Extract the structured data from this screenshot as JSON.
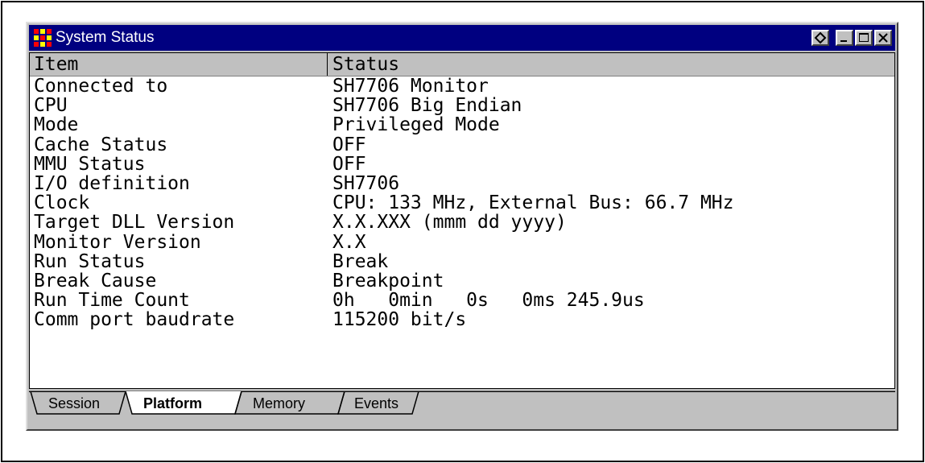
{
  "window": {
    "title": "System Status",
    "icon": "app-grid-icon",
    "buttons": [
      "restore-diamond-icon",
      "minimize-icon",
      "maximize-icon",
      "close-icon"
    ]
  },
  "table": {
    "columns": [
      "Item",
      "Status"
    ],
    "rows": [
      {
        "item": "Connected to",
        "status": "SH7706 Monitor"
      },
      {
        "item": "CPU",
        "status": "SH7706 Big Endian"
      },
      {
        "item": "Mode",
        "status": "Privileged Mode"
      },
      {
        "item": "Cache Status",
        "status": "OFF"
      },
      {
        "item": "MMU Status",
        "status": "OFF"
      },
      {
        "item": "I/O definition",
        "status": "SH7706"
      },
      {
        "item": "Clock",
        "status": "CPU: 133 MHz, External Bus: 66.7 MHz"
      },
      {
        "item": "Target DLL Version",
        "status": "X.X.XXX (mmm dd yyyy)"
      },
      {
        "item": "Monitor Version",
        "status": "X.X"
      },
      {
        "item": "Run Status",
        "status": "Break"
      },
      {
        "item": "Break Cause",
        "status": "Breakpoint"
      },
      {
        "item": "Run Time Count",
        "status": "0h   0min   0s   0ms 245.9us"
      },
      {
        "item": "Comm port baudrate",
        "status": "115200 bit/s"
      }
    ]
  },
  "tabs": [
    {
      "label": "Session",
      "active": false
    },
    {
      "label": "Platform",
      "active": true
    },
    {
      "label": "Memory",
      "active": false
    },
    {
      "label": "Events",
      "active": false
    }
  ],
  "colors": {
    "titlebar": "#000080",
    "face": "#c0c0c0"
  }
}
